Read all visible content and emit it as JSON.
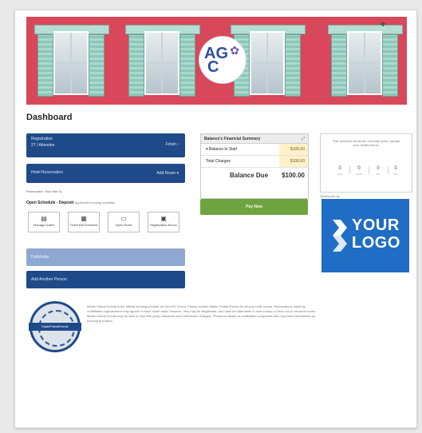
{
  "page": {
    "title": "Dashboard"
  },
  "banner": {
    "logo_line1": "AG",
    "logo_line2": "C"
  },
  "left": {
    "registration": {
      "label1": "Registration",
      "label2": "27 / Attendee",
      "right": "Finish"
    },
    "hotel": {
      "label": "Hotel Reservation",
      "right": "Add Room"
    },
    "reservation_note": "Reservation: Mon Mar 01",
    "open_schedule": {
      "title": "Open Schedule - Deposit",
      "subtitle": "Applicable booking available"
    },
    "tiles": [
      "Manage Dates",
      "Ticket Bid Schedule",
      "Open Roles",
      "Registration Bonus"
    ],
    "light_button": "Pathfinder",
    "dark_button": "Add Another Person",
    "badge_text": "MadeFinestEvents",
    "paragraph": "Madie Global Events is the official housing provider for the AGC Event. Please contact Madie Global Events for all your hotel needs. Reservations made by unaffiliated organizations may appear to have lower rates; however, they may be illegitimate, and have led attendees to lose money or miss out on secured rooms. Madie Global Events may be able to help with group discounts and unforeseen changes. Please be aware of unaffiliated companies who represent themselves as housing providers."
  },
  "finance": {
    "header": "Balance's Financial Summary",
    "rows": [
      {
        "label": "Balance to Start",
        "value": "$100.00"
      },
      {
        "label": "Total Charges",
        "value": "$100.00"
      }
    ],
    "due_label": "Balance Due",
    "due_value": "$100.00",
    "pay_button": "Pay Now"
  },
  "right": {
    "countdown_msg": "This session's funds are currently open. Update your details below.",
    "countdown": [
      {
        "n": "0",
        "u": "Days"
      },
      {
        "n": "0",
        "u": "Hours"
      },
      {
        "n": "0",
        "u": "Min"
      },
      {
        "n": "0",
        "u": "Sec"
      }
    ],
    "caption": "Sponsored by",
    "logo_word1": "YOUR",
    "logo_word2": "LOGO"
  },
  "colors": {
    "primary": "#1f4a8a",
    "green": "#6fa33f",
    "banner": "#d9475a",
    "logo_bg": "#1f6dc4"
  }
}
